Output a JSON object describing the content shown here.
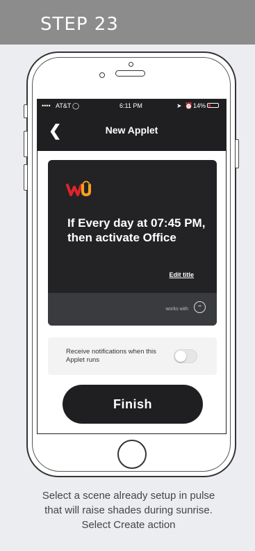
{
  "step": {
    "title": "STEP 23"
  },
  "status_bar": {
    "carrier": "AT&T",
    "time": "6:11 PM",
    "battery": "14%"
  },
  "nav": {
    "back_icon": "chevron-left-icon",
    "title": "New Applet"
  },
  "applet": {
    "title": "If Every day at 07:45 PM, then activate Office",
    "edit_title": "Edit title",
    "works_with": "works with"
  },
  "notification": {
    "label": "Receive notifications when this Applet runs",
    "toggle_on": false
  },
  "finish_button": "Finish",
  "caption": "Select a scene already setup in pulse that will raise shades during sunrise. Select Create action",
  "colors": {
    "header": "#8c8c8c",
    "dark": "#1f1f21",
    "card": "#232326",
    "accent_red": "#e0242b",
    "accent_orange": "#f7a21b"
  }
}
